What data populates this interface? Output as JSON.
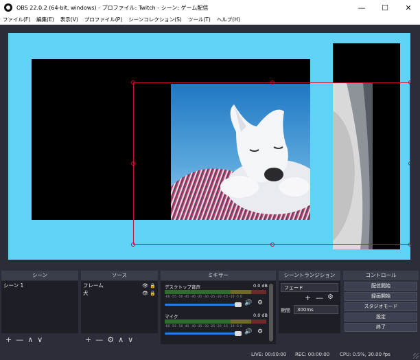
{
  "window": {
    "title": "OBS 22.0.2 (64-bit, windows) - プロファイル: Twitch - シーン: ゲーム配信",
    "minimize": "—",
    "maximize": "☐",
    "close": "✕"
  },
  "menu": [
    "ファイル(F)",
    "編集(E)",
    "表示(V)",
    "プロファイル(P)",
    "シーンコレクション(S)",
    "ツール(T)",
    "ヘルプ(H)"
  ],
  "colors": {
    "canvas": "#5fd3f5",
    "selection": "#c8102e",
    "panel": "#1e1f26",
    "accent": "#2a7ce0"
  },
  "docks": {
    "scenes": {
      "title": "シーン",
      "items": [
        "シーン 1"
      ]
    },
    "sources": {
      "title": "ソース",
      "items": [
        "フレーム",
        "犬"
      ]
    },
    "mixer": {
      "title": "ミキサー",
      "channels": [
        {
          "name": "デスクトップ音声",
          "db": "0.0 dB"
        },
        {
          "name": "マイク",
          "db": "0.0 dB"
        }
      ],
      "scale": "-60 -55 -50 -45 -40 -35 -30 -25 -20 -15 -10 -5 0"
    },
    "transitions": {
      "title": "シーントランジション",
      "selected": "フェード",
      "duration_label": "期間",
      "duration": "300ms"
    },
    "controls": {
      "title": "コントロール",
      "buttons": [
        "配信開始",
        "録画開始",
        "スタジオモード",
        "設定",
        "終了"
      ]
    }
  },
  "toolbar_icons": {
    "add": "+",
    "remove": "—",
    "up": "∧",
    "down": "∨",
    "gear": "⚙"
  },
  "status": {
    "live": "LIVE: 00:00:00",
    "rec": "REC: 00:00:00",
    "cpu": "CPU: 0.5%, 30.00 fps"
  }
}
